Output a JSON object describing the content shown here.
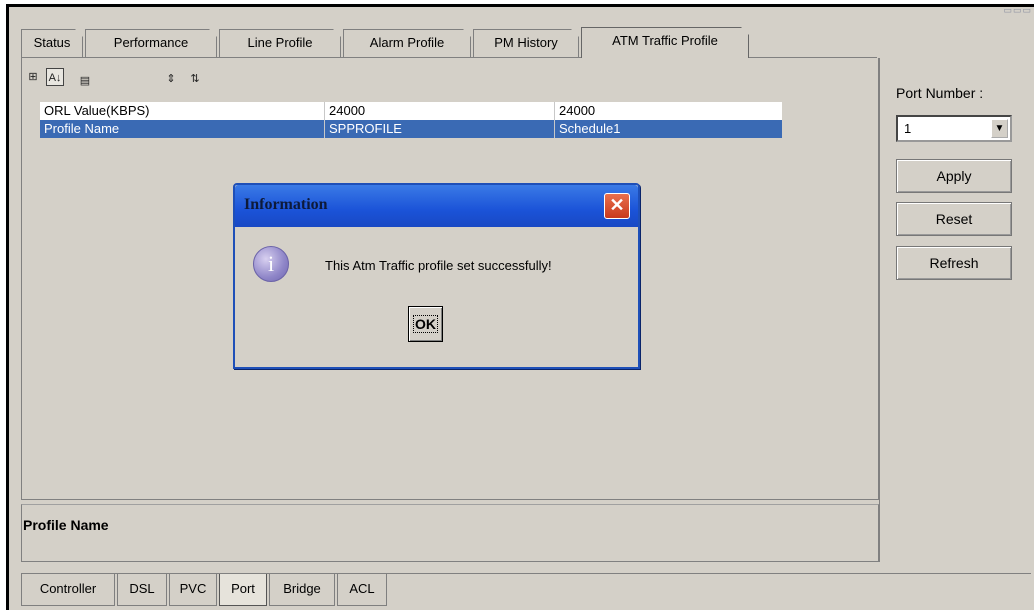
{
  "tabs_top": [
    {
      "label": "Status",
      "active": false
    },
    {
      "label": "Performance",
      "active": false
    },
    {
      "label": "Line Profile",
      "active": false
    },
    {
      "label": "Alarm Profile",
      "active": false
    },
    {
      "label": "PM History",
      "active": false
    },
    {
      "label": "ATM Traffic Profile",
      "active": true
    }
  ],
  "toolbar": {
    "icons": [
      "categorized-view-icon",
      "sort-alphabetical-icon",
      "description-toggle-icon",
      "expand-all-icon",
      "collapse-all-icon"
    ],
    "glyphs": [
      "⊞",
      "A↓",
      "▤",
      "⇕",
      "⇅"
    ]
  },
  "grid": {
    "rows": [
      {
        "name": "ORL Value(KBPS)",
        "value1": "24000",
        "value2": "24000",
        "selected": false
      },
      {
        "name": "Profile Name",
        "value1": "SPPROFILE",
        "value2": "Schedule1",
        "selected": true
      }
    ]
  },
  "description": {
    "title": "Profile Name"
  },
  "right_panel": {
    "port_label": "Port Number :",
    "port_value": "1",
    "buttons": {
      "apply": "Apply",
      "reset": "Reset",
      "refresh": "Refresh"
    }
  },
  "tabs_bottom": [
    {
      "label": "Controller",
      "active": false
    },
    {
      "label": "DSL",
      "active": false
    },
    {
      "label": "PVC",
      "active": false
    },
    {
      "label": "Port",
      "active": true
    },
    {
      "label": "Bridge",
      "active": false
    },
    {
      "label": "ACL",
      "active": false
    }
  ],
  "dialog": {
    "title": "Information",
    "message": "This Atm Traffic profile set successfully!",
    "ok_label": "OK",
    "close_glyph": "✕",
    "info_glyph": "i"
  },
  "colors": {
    "selection": "#3a6ab4",
    "dialog_title": "#1b53d8",
    "close_button": "#d9552f"
  }
}
